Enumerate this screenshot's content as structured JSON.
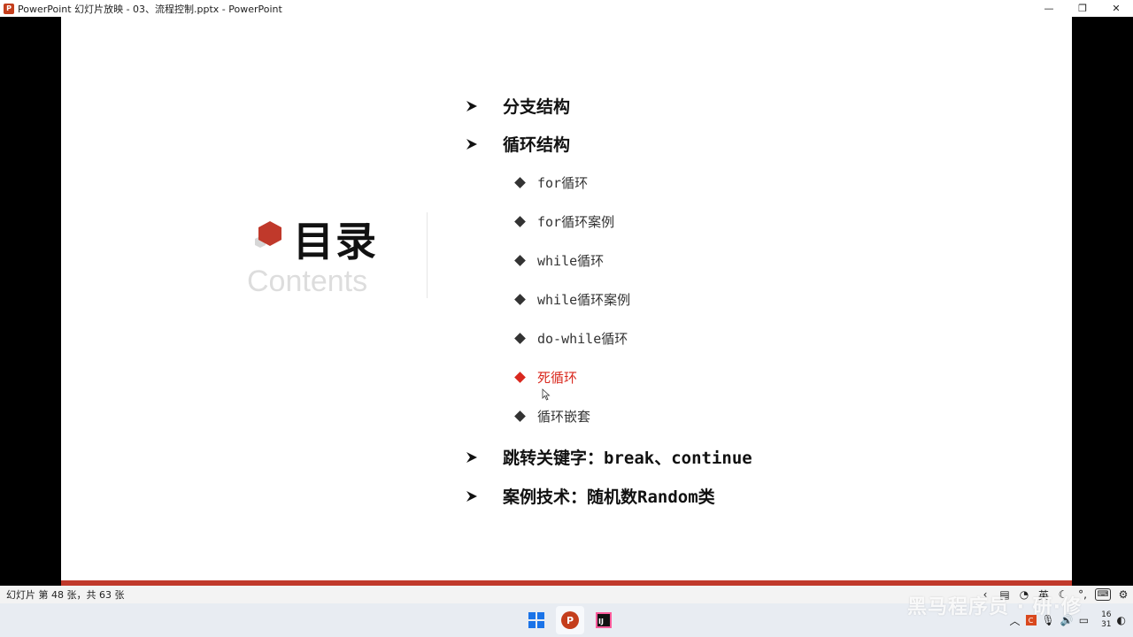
{
  "window": {
    "title": "PowerPoint 幻灯片放映 - 03、流程控制.pptx - PowerPoint",
    "app_icon_letter": "P",
    "minimize_glyph": "—",
    "restore_glyph": "❐",
    "close_glyph": "✕"
  },
  "slide": {
    "heading": "目录",
    "subheading": "Contents",
    "accent_color": "#c0392b",
    "toc": [
      {
        "level": 1,
        "text": "分支结构"
      },
      {
        "level": 1,
        "text": "循环结构"
      },
      {
        "level": 2,
        "text": "for循环"
      },
      {
        "level": 2,
        "text": "for循环案例"
      },
      {
        "level": 2,
        "text": "while循环"
      },
      {
        "level": 2,
        "text": "while循环案例"
      },
      {
        "level": 2,
        "text": "do-while循环"
      },
      {
        "level": 2,
        "text": "死循环",
        "active": true
      },
      {
        "level": 2,
        "text": "循环嵌套"
      },
      {
        "level": 1,
        "text": "跳转关键字：break、continue"
      },
      {
        "level": 1,
        "text": "案例技术：随机数Random类"
      }
    ]
  },
  "statusbar": {
    "slide_count": "幻灯片 第 48 张，共 63 张",
    "ime_lang": "英",
    "ime_punct": "°,"
  },
  "taskbar": {
    "ppt_letter": "P",
    "idea_letters": "IJ",
    "clock_line1": "16",
    "clock_line2": "31"
  },
  "watermark": "黑马程序员 · 研·修"
}
